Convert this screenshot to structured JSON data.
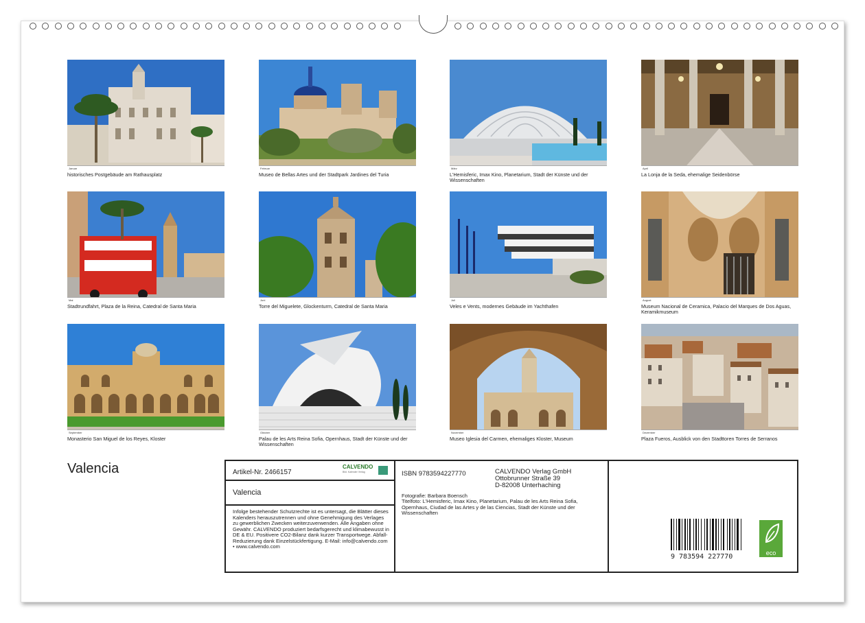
{
  "calendar": {
    "title": "Valencia",
    "photos": [
      {
        "month": "Januar",
        "caption": "historisches Postgebäude am Rathausplatz",
        "scene": "city-hall"
      },
      {
        "month": "Februar",
        "caption": "Museo de Bellas Artes und der Stadtpark Jardines del Turia",
        "scene": "museum-park"
      },
      {
        "month": "März",
        "caption": "L'Hemisferic, Imax Kino, Planetarium, Stadt der Künste und der Wissenschaften",
        "scene": "hemisferic"
      },
      {
        "month": "April",
        "caption": "La Lonja de la Seda, ehemalige Seidenbörse",
        "scene": "lonja"
      },
      {
        "month": "Mai",
        "caption": "Stadtrundfahrt, Plaza de la Reina, Catedral de Santa Maria",
        "scene": "bus"
      },
      {
        "month": "Juni",
        "caption": "Torre del Miguelete, Glockenturm, Catedral de Santa Maria",
        "scene": "tower"
      },
      {
        "month": "Juli",
        "caption": "Veles e Vents, modernes Gebäude im Yachthafen",
        "scene": "veles"
      },
      {
        "month": "August",
        "caption": "Museum Nacional de Ceramica, Palacio del Marques de Dos Aguas, Keramikmuseum",
        "scene": "ceramica"
      },
      {
        "month": "September",
        "caption": "Monasterio San Miguel de los Reyes, Kloster",
        "scene": "monastery"
      },
      {
        "month": "Oktober",
        "caption": "Palau de les Arts Reina Sofia, Opernhaus, Stadt der Künste und der Wissenschaften",
        "scene": "palau"
      },
      {
        "month": "November",
        "caption": "Museo Iglesia del Carmen, ehemaliges Kloster, Museum",
        "scene": "carmen"
      },
      {
        "month": "Dezember",
        "caption": "Plaza Fueros, Ausblick von den Stadttoren Torres de Serranos",
        "scene": "rooftops"
      }
    ]
  },
  "info": {
    "artikel": "Artikel-Nr. 2466157",
    "brand_logo_text": "CALVENDO",
    "brand_logo_sub": "Bild. Kalender Verlag",
    "product_title": "Valencia",
    "legal": "Infolge bestehender Schutzrechte ist es untersagt, die Blätter dieses Kalenders herauszutrennen und ohne Genehmigung des Verlages zu gewerblichen Zwecken weiterzuverwenden. Alle Angaben ohne Gewähr. CALVENDO produziert bedarfsgerecht und klimabewusst in DE & EU. Positivere CO2-Bilanz dank kurzer Transportwege. Abfall-Reduzierung dank Einzelstückfertigung. E-Mail: info@calvendo.com • www.calvendo.com",
    "isbn": "ISBN 9783594227770",
    "publisher_name": "CALVENDO Verlag GmbH",
    "publisher_street": "Ottobrunner Straße 39",
    "publisher_city": "D-82008 Unterhaching",
    "photographer": "Fotografie: Barbara Boensch",
    "cover_photo": "Titelfoto: L'Hemisferic, Imax Kino, Planetarium, Palau de les Arts Reina Sofia, Opernhaus, Ciudad de las Artes y de las Ciencias, Stadt der Künste und der Wissenschaften",
    "barcode_number": "9 783594 227770",
    "eco_label": "eco"
  }
}
